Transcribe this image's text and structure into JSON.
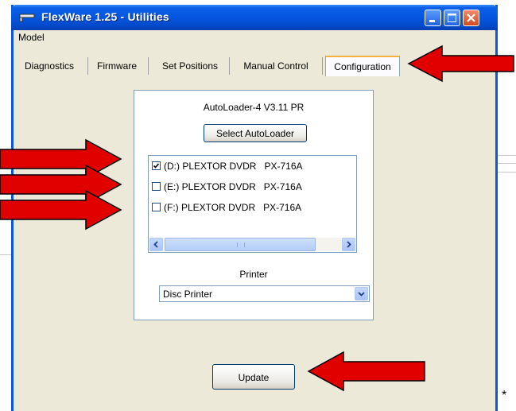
{
  "window": {
    "title": "FlexWare 1.25 - Utilities"
  },
  "menu": {
    "items": [
      "Model"
    ]
  },
  "tabs": [
    {
      "label": "Diagnostics",
      "active": false
    },
    {
      "label": "Firmware",
      "active": false
    },
    {
      "label": "Set Positions",
      "active": false
    },
    {
      "label": "Manual Control",
      "active": false
    },
    {
      "label": "Configuration",
      "active": true
    }
  ],
  "config": {
    "autoloader_title": "AutoLoader-4 V3.11 PR",
    "select_button": "Select AutoLoader",
    "drives": [
      {
        "label": "(D:) PLEXTOR DVDR   PX-716A",
        "checked": true
      },
      {
        "label": "(E:) PLEXTOR DVDR   PX-716A",
        "checked": false
      },
      {
        "label": "(F:) PLEXTOR DVDR   PX-716A",
        "checked": false
      }
    ],
    "printer_label": "Printer",
    "printer_value": "Disc Printer",
    "update_button": "Update"
  },
  "footnote": "*",
  "colors": {
    "title_bar": "#0556e0",
    "annotation_arrow": "#e00000",
    "close_button": "#d34a1e"
  }
}
